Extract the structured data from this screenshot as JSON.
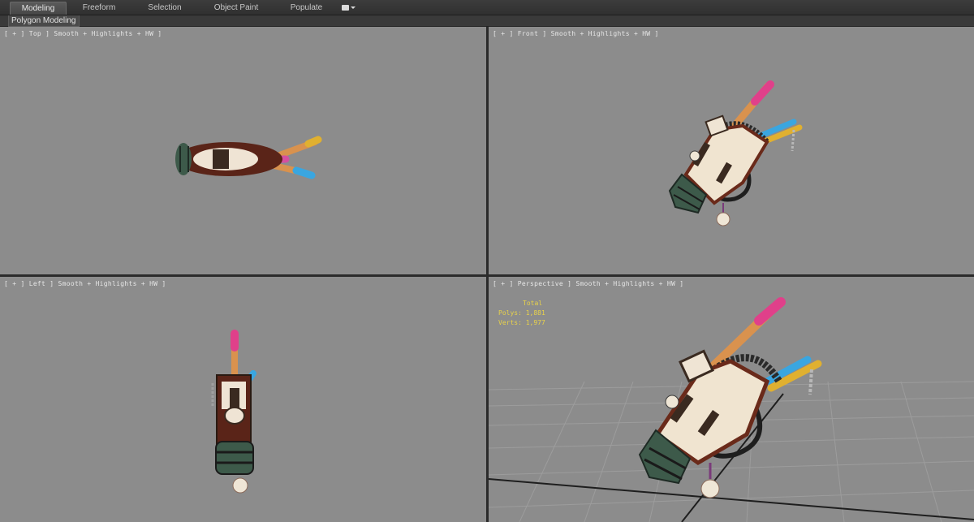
{
  "ribbon": {
    "tabs": [
      {
        "label": "Modeling",
        "active": true
      },
      {
        "label": "Freeform",
        "active": false
      },
      {
        "label": "Selection",
        "active": false
      },
      {
        "label": "Object Paint",
        "active": false
      },
      {
        "label": "Populate",
        "active": false
      }
    ],
    "panel_label": "Polygon Modeling"
  },
  "viewports": {
    "top": {
      "label": "[ + ] Top ] Smooth + Highlights + HW ]"
    },
    "front": {
      "label": "[ + ] Front ] Smooth + Highlights + HW ]"
    },
    "left": {
      "label": "[ + ] Left ] Smooth + Highlights + HW ]"
    },
    "perspective": {
      "label": "[ + ] Perspective ] Smooth + Highlights + HW ]",
      "stats": {
        "total": "Total",
        "polys": "Polys: 1,881",
        "verts": "Verts: 1,977"
      }
    }
  },
  "colors": {
    "viewport_bg": "#8c8c8c",
    "stats_text": "#e8d24a",
    "bat_pink": "#e0408a",
    "bat_wood": "#d9924e",
    "bat_blue": "#3aa6e0",
    "bat_yellow": "#e0b030",
    "bag_cream": "#f0e4d0",
    "bag_brown": "#5a2418",
    "cage_green": "#3d5a4a"
  }
}
